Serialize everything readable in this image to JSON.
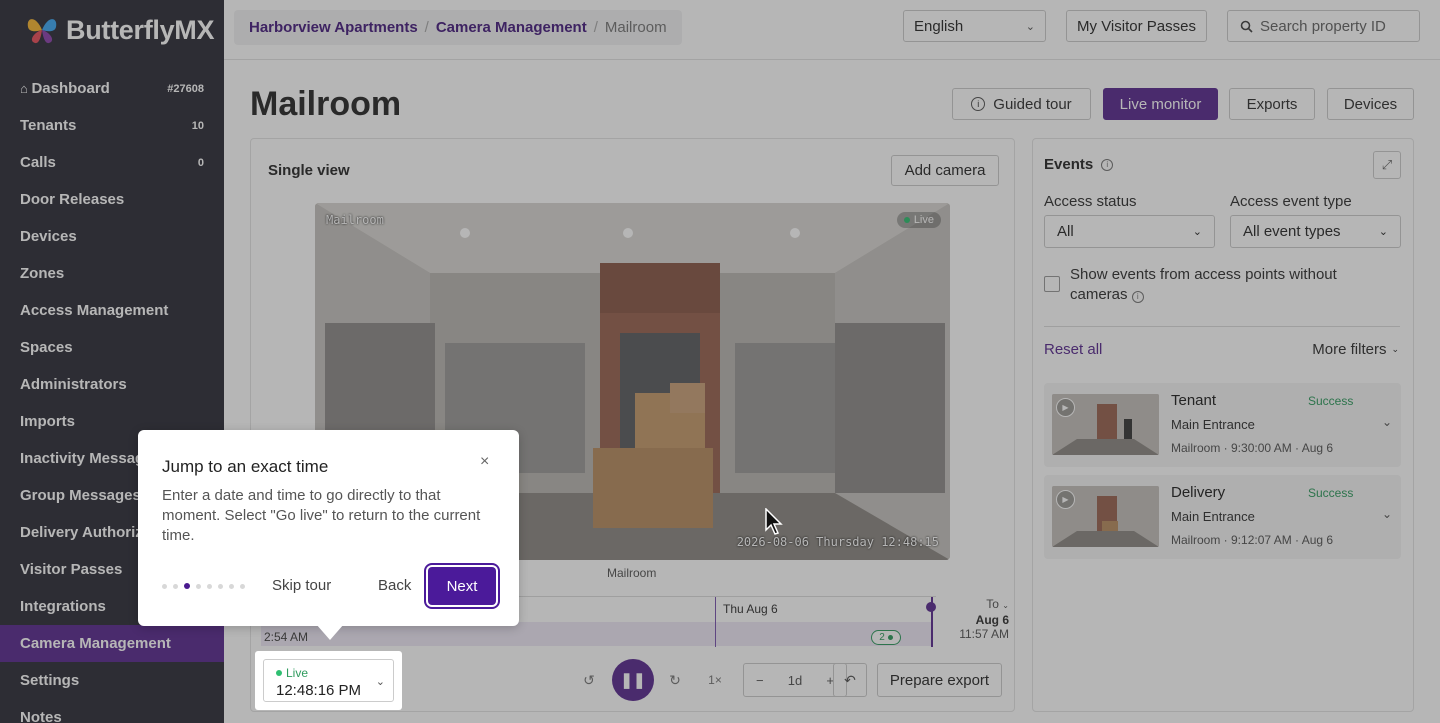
{
  "app": {
    "logo": "ButterflyMX"
  },
  "sidebar": {
    "items": [
      {
        "label": "Dashboard",
        "count": "#27608"
      },
      {
        "label": "Tenants",
        "count": "10"
      },
      {
        "label": "Calls",
        "count": "0"
      },
      {
        "label": "Door Releases",
        "count": ""
      },
      {
        "label": "Devices",
        "count": ""
      },
      {
        "label": "Zones",
        "count": ""
      },
      {
        "label": "Access Management",
        "count": ""
      },
      {
        "label": "Spaces",
        "count": ""
      },
      {
        "label": "Administrators",
        "count": ""
      },
      {
        "label": "Imports",
        "count": ""
      },
      {
        "label": "Inactivity Messages",
        "count": ""
      },
      {
        "label": "Group Messages",
        "count": ""
      },
      {
        "label": "Delivery Authorizations",
        "count": ""
      },
      {
        "label": "Visitor Passes",
        "count": ""
      },
      {
        "label": "Integrations",
        "count": ""
      },
      {
        "label": "Camera Management",
        "count": ""
      },
      {
        "label": "Settings",
        "count": ""
      },
      {
        "label": "Notes",
        "count": ""
      }
    ]
  },
  "header": {
    "breadcrumb": [
      "Harborview Apartments",
      "Camera Management",
      "Mailroom"
    ],
    "language": "English",
    "visitor_passes": "My Visitor Passes",
    "search_placeholder": "Search property ID"
  },
  "page": {
    "title": "Mailroom",
    "buttons": {
      "guided_tour": "Guided tour",
      "live_monitor": "Live monitor",
      "exports": "Exports",
      "devices": "Devices"
    }
  },
  "viewer": {
    "label": "Single view",
    "add_camera": "Add camera",
    "video_label": "Mailroom",
    "live_badge": "Live",
    "timestamp": "2026-08-06 Thursday 12:48:15",
    "camera_name": "Mailroom",
    "timeline": {
      "start": "2:54 AM",
      "day_marker": "Thu Aug 6",
      "to_label": "To",
      "to_date": "Aug 6",
      "to_time": "11:57 AM",
      "event_count": "2"
    },
    "live_select": {
      "status": "Live",
      "time": "12:48:16 PM"
    },
    "speed": "1×",
    "zoom": "1d",
    "prepare_export": "Prepare export"
  },
  "events": {
    "title": "Events",
    "access_status_label": "Access status",
    "access_status_value": "All",
    "event_type_label": "Access event type",
    "event_type_value": "All event types",
    "checkbox_label": "Show events from access points without cameras",
    "reset_all": "Reset all",
    "more_filters": "More filters",
    "items": [
      {
        "type": "Tenant",
        "status": "Success",
        "location": "Main Entrance",
        "meta": "Mailroom · 9:30:00 AM · Aug 6"
      },
      {
        "type": "Delivery",
        "status": "Success",
        "location": "Main Entrance",
        "meta": "Mailroom · 9:12:07 AM · Aug 6"
      }
    ]
  },
  "tour": {
    "title": "Jump to an exact time",
    "text": "Enter a date and time to go directly to that moment. Select \"Go live\" to return to the current time.",
    "skip": "Skip tour",
    "back": "Back",
    "next": "Next",
    "step": 3,
    "total_steps": 8
  },
  "colors": {
    "brand": "#5b2d91",
    "sidebar": "#2f2f3a",
    "success": "#2f9b5e"
  }
}
